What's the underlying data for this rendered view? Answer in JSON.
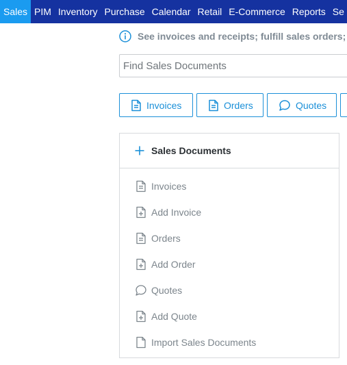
{
  "nav": {
    "items": [
      {
        "label": "Sales",
        "active": true
      },
      {
        "label": "PIM"
      },
      {
        "label": "Inventory"
      },
      {
        "label": "Purchase"
      },
      {
        "label": "Calendar"
      },
      {
        "label": "Retail"
      },
      {
        "label": "E-Commerce"
      },
      {
        "label": "Reports"
      },
      {
        "label": "Se"
      }
    ]
  },
  "info": {
    "text": "See invoices and receipts; fulfill sales orders; se",
    "icon": "info-icon"
  },
  "search": {
    "placeholder": "Find Sales Documents",
    "value": ""
  },
  "tabs": [
    {
      "label": "Invoices",
      "icon": "document-icon"
    },
    {
      "label": "Orders",
      "icon": "document-icon"
    },
    {
      "label": "Quotes",
      "icon": "speech-bubble-icon"
    }
  ],
  "panel": {
    "title": "Sales Documents",
    "items": [
      {
        "label": "Invoices",
        "icon": "document-icon"
      },
      {
        "label": "Add Invoice",
        "icon": "add-document-icon"
      },
      {
        "label": "Orders",
        "icon": "document-icon"
      },
      {
        "label": "Add Order",
        "icon": "add-document-icon"
      },
      {
        "label": "Quotes",
        "icon": "speech-bubble-icon"
      },
      {
        "label": "Add Quote",
        "icon": "add-document-icon"
      },
      {
        "label": "Import Sales Documents",
        "icon": "blank-document-icon"
      }
    ]
  },
  "colors": {
    "nav_bg": "#1532a0",
    "nav_active": "#1a9bf0",
    "accent": "#1a8fd8",
    "muted_text": "#7c858c"
  }
}
